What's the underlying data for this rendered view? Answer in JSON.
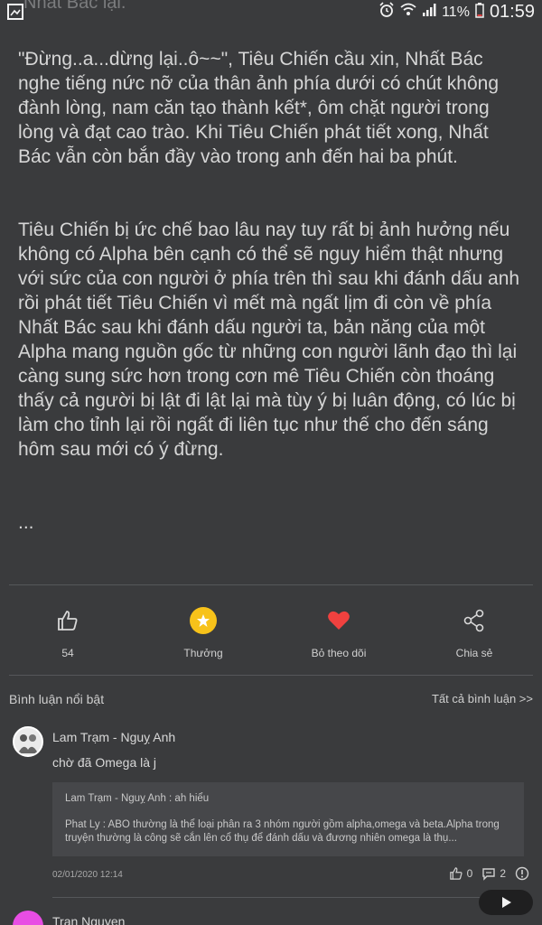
{
  "status_bar": {
    "bleed_title": "Nhất Bác lại.",
    "battery": "11%",
    "time": "01:59"
  },
  "story": {
    "paragraphs": [
      "\"Đừng..a...dừng lại..ô~~\",  Tiêu Chiến cầu xin, Nhất Bác nghe tiếng nức nỡ của thân ảnh phía dưới có chút không đành lòng, nam căn tạo thành kết*, ôm chặt người trong lòng và đạt cao trào. Khi Tiêu Chiến phát tiết xong, Nhất Bác vẫn còn bắn đầy vào trong anh đến hai ba phút.",
      "Tiêu Chiến bị ức chế bao lâu nay tuy rất bị ảnh hưởng nếu không có Alpha bên cạnh có thể sẽ nguy hiểm thật nhưng với sức của con người ở phía trên thì sau khi đánh dấu anh rồi phát tiết Tiêu Chiến vì mết mà ngất lịm đi còn về phía Nhất Bác sau khi đánh dấu người ta, bản năng của một Alpha mang nguồn gốc từ những con người lãnh đạo thì lại càng sung sức hơn trong cơn mê Tiêu Chiến còn thoáng thấy cả người bị lật đi lật lại mà tùy ý bị luân động, có lúc bị làm cho tỉnh lại rồi ngất đi liên tục như thế cho đến sáng hôm sau mới có ý đừng.",
      "..."
    ]
  },
  "actions": {
    "like_count": "54",
    "reward_label": "Thưởng",
    "unfollow_label": "Bỏ theo dõi",
    "share_label": "Chia sẻ"
  },
  "comments": {
    "header": "Bình luận nổi bật",
    "all_label": "Tất cả bình luận >>",
    "items": [
      {
        "name": "Lam Trạm - Nguỵ Anh",
        "text": "chờ đã Omega là j",
        "replies": [
          "Lam Trạm - Nguỵ Anh : ah hiểu",
          "Phat Ly : ABO thường là thể loại phân ra 3 nhóm người gồm alpha,omega và beta.Alpha trong truyện thường là công sẽ cắn lên cổ thụ để đánh dấu và đương nhiên omega là thụ..."
        ],
        "date": "02/01/2020 12:14",
        "likes": "0",
        "replies_count": "2"
      },
      {
        "name": "Tran Nguyen"
      }
    ]
  }
}
